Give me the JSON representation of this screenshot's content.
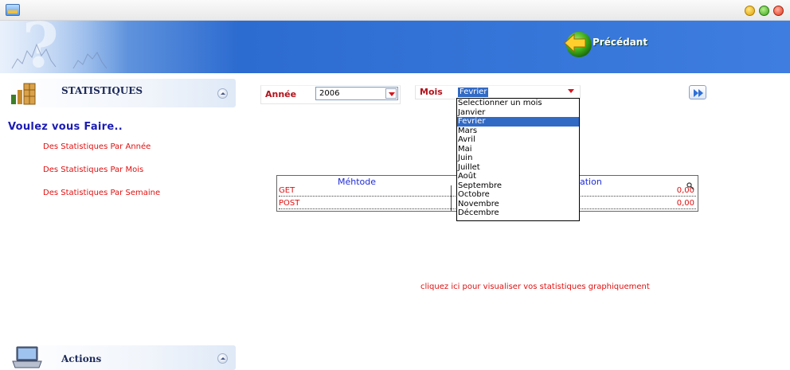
{
  "window": {
    "icons": {
      "app": "app-icon",
      "minimize": "minimize-icon",
      "maximize": "maximize-icon",
      "close": "close-icon"
    }
  },
  "banner": {
    "previous_label": "Précédant",
    "previous_icon": "back-arrow-icon"
  },
  "sidebar": {
    "statistics_header": "STATISTIQUES",
    "question": "Voulez vous Faire..",
    "links": [
      "Des Statistiques Par Année",
      "Des Statistiques Par Mois",
      "Des Statistiques Par Semaine"
    ],
    "actions_header": "Actions"
  },
  "filters": {
    "year_label": "Année",
    "year_value": "2006",
    "month_label": "Mois",
    "month_value": "Fevrier",
    "month_options": [
      "Selectionner un mois",
      "Janvier",
      "Fevrier",
      "Mars",
      "Avril",
      "Mai",
      "Juin",
      "Juillet",
      "Août",
      "Septembre",
      "Octobre",
      "Novembre",
      "Décembre"
    ],
    "selected_index": 2
  },
  "table": {
    "col_method": "Méhtode",
    "col_right_partial": "ation",
    "rows": [
      {
        "method": "GET",
        "value": "0,00"
      },
      {
        "method": "POST",
        "value": "0,00"
      }
    ]
  },
  "graph_link": "cliquez ici pour visualiser vos statistiques graphiquement",
  "colors": {
    "accent_red": "#e01010",
    "link_blue": "#1c1cb4",
    "banner_blue": "#2c6bd0",
    "selection": "#316ac5"
  }
}
